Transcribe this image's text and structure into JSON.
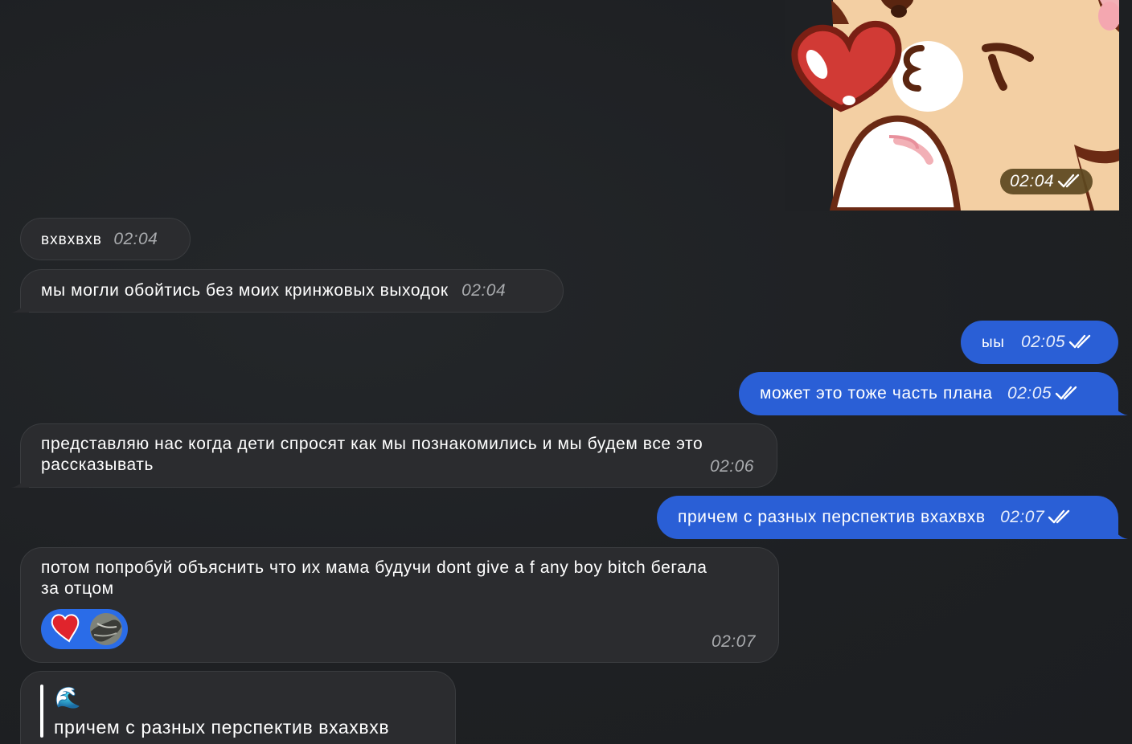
{
  "sticker": {
    "time": "02:04"
  },
  "messages": [
    {
      "text": "вхвхвхв",
      "time": "02:04"
    },
    {
      "text": "мы могли обойтись без моих кринжовых выходок",
      "time": "02:04"
    },
    {
      "text": "ыы",
      "time": "02:05"
    },
    {
      "text": "может это тоже часть плана",
      "time": "02:05"
    },
    {
      "text_line1": "представляю нас когда дети спросят как мы познакомились и мы будем все это",
      "text_line2": "рассказывать",
      "time": "02:06"
    },
    {
      "text": "причем с разных перспектив вхахвхв",
      "time": "02:07"
    },
    {
      "text_line1": "потом попробуй объяснить что их мама будучи dont give a f any boy bitch бегала",
      "text_line2": "за отцом",
      "time": "02:07",
      "reaction": "heart"
    },
    {
      "reply_emoji": "🌊",
      "reply_text": "причем с разных перспектив вхахвхв"
    }
  ],
  "colors": {
    "background": "#1f2124",
    "incoming_bubble": "#2b2c2f",
    "outgoing_bubble": "#2a5fd6",
    "reaction_pill": "#2a6ce8",
    "heart": "#e0242c"
  }
}
